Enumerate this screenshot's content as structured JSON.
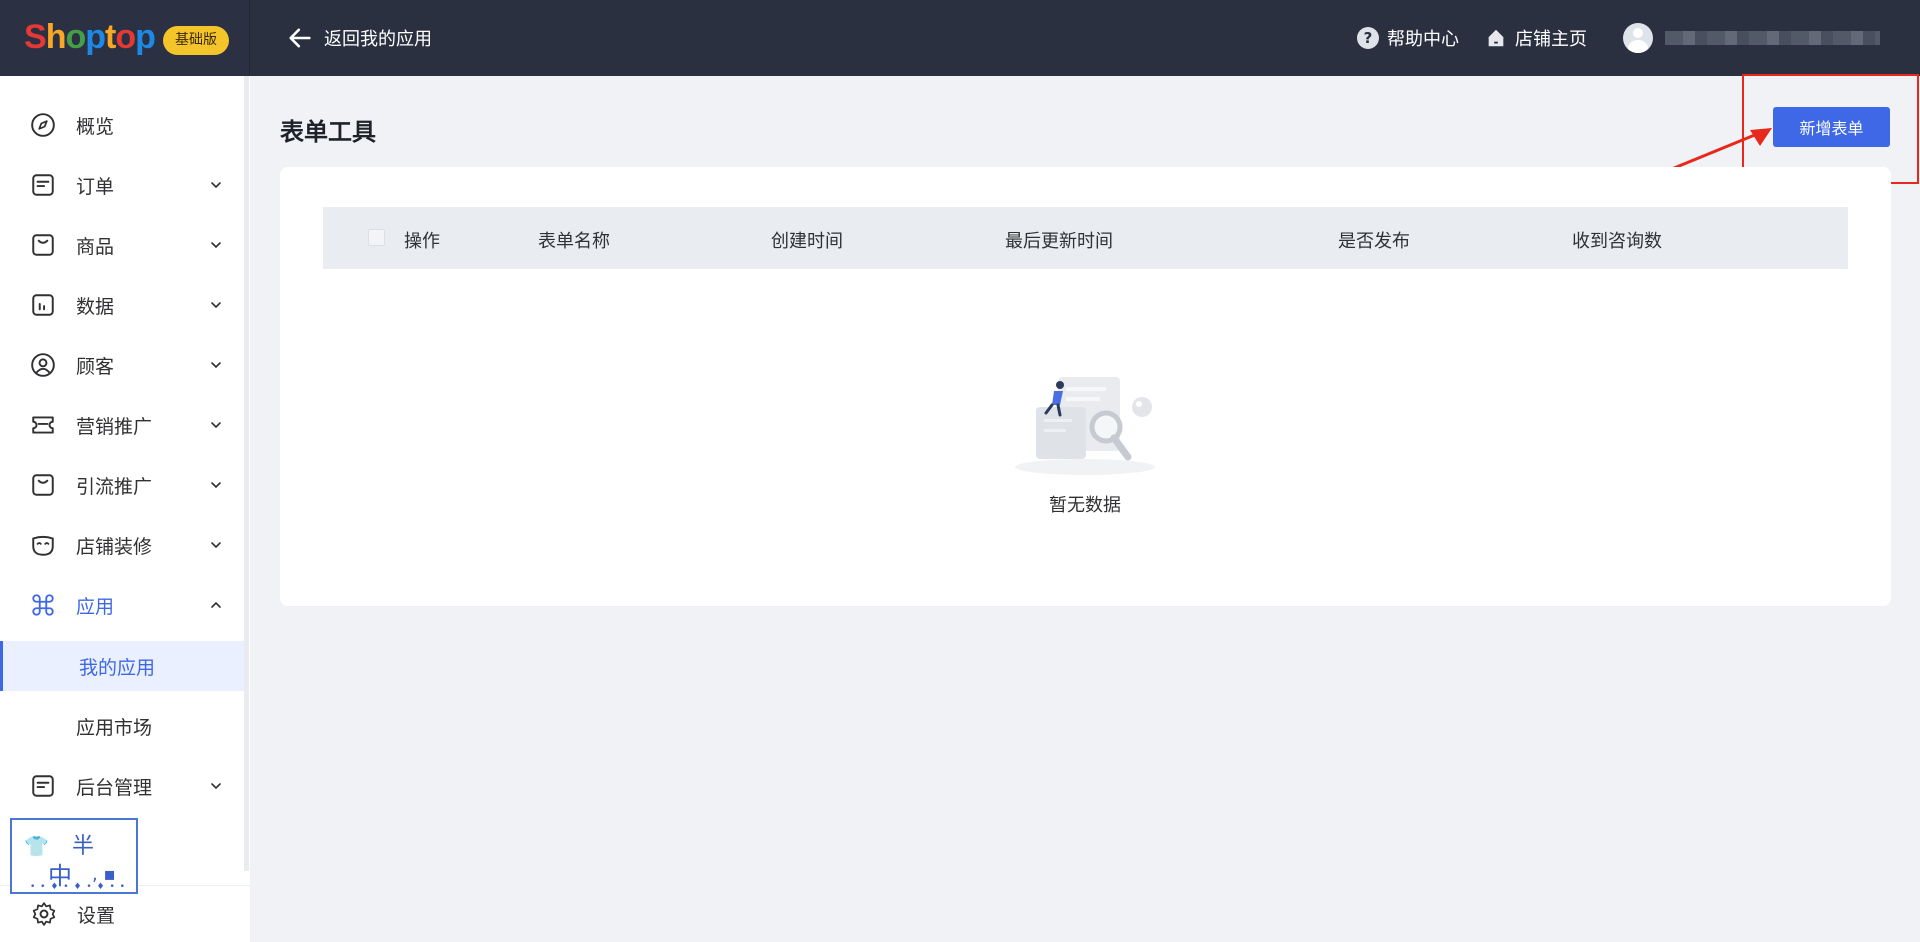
{
  "header": {
    "logo": "Shoptop",
    "logo_letters": [
      {
        "ch": "S",
        "color": "#e53935"
      },
      {
        "ch": "h",
        "color": "#f9a825"
      },
      {
        "ch": "o",
        "color": "#43a047"
      },
      {
        "ch": "p",
        "color": "#1e88e5"
      },
      {
        "ch": "t",
        "color": "#f9a825"
      },
      {
        "ch": "o",
        "color": "#e53935"
      },
      {
        "ch": "p",
        "color": "#1e88e5"
      }
    ],
    "plan_badge": "基础版",
    "back_label": "返回我的应用",
    "help_label": "帮助中心",
    "store_label": "店铺主页"
  },
  "sidebar": {
    "items": [
      {
        "label": "概览",
        "icon": "compass-icon"
      },
      {
        "label": "订单",
        "icon": "order-icon"
      },
      {
        "label": "商品",
        "icon": "bag-icon"
      },
      {
        "label": "数据",
        "icon": "chart-icon"
      },
      {
        "label": "顾客",
        "icon": "user-icon"
      },
      {
        "label": "营销推广",
        "icon": "ticket-icon"
      },
      {
        "label": "引流推广",
        "icon": "bag-icon"
      },
      {
        "label": "店铺装修",
        "icon": "mask-icon"
      },
      {
        "label": "应用",
        "icon": "apps-icon"
      },
      {
        "label": "后台管理",
        "icon": "order-icon"
      }
    ],
    "sub_items": [
      "我的应用",
      "应用市场"
    ],
    "settings_label": "设置"
  },
  "ime": {
    "ban": "半",
    "zhong": "中"
  },
  "main": {
    "title": "表单工具",
    "add_button": "新增表单",
    "columns": [
      "操作",
      "表单名称",
      "创建时间",
      "最后更新时间",
      "是否发布",
      "收到咨询数"
    ],
    "empty_text": "暂无数据"
  },
  "colors": {
    "accent": "#3f68e7",
    "topbar": "#2a3040",
    "annotation": "#e8281c"
  }
}
